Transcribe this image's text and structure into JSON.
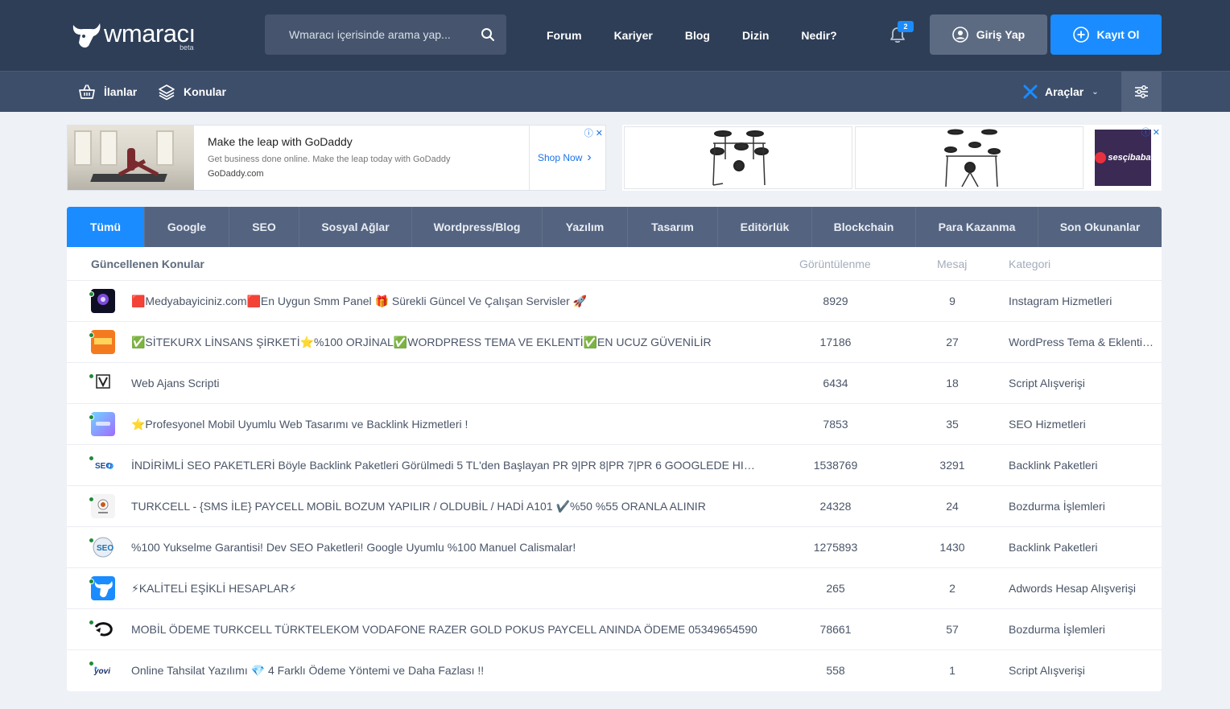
{
  "header": {
    "logo": {
      "name": "wmaracı",
      "tag": "beta"
    },
    "search": {
      "placeholder": "Wmaracı içerisinde arama yap..."
    },
    "nav": [
      "Forum",
      "Kariyer",
      "Blog",
      "Dizin",
      "Nedir?"
    ],
    "notifications": {
      "count": "2"
    },
    "login_label": "Giriş Yap",
    "register_label": "Kayıt Ol",
    "colors": {
      "bar": "#2e3e57",
      "accent": "#1a8cff"
    }
  },
  "subnav": {
    "listings_label": "İlanlar",
    "topics_label": "Konular",
    "tools_label": "Araçlar"
  },
  "ads": {
    "left": {
      "title": "Make the leap with GoDaddy",
      "description": "Get business done online. Make the leap today with GoDaddy",
      "domain": "GoDaddy.com",
      "cta": "Shop Now"
    },
    "right": {
      "brand": "sesçibaba"
    }
  },
  "tabs": [
    "Tümü",
    "Google",
    "SEO",
    "Sosyal Ağlar",
    "Wordpress/Blog",
    "Yazılım",
    "Tasarım",
    "Editörlük",
    "Blockchain",
    "Para Kazanma",
    "Son Okunanlar"
  ],
  "table": {
    "columns": {
      "title": "Güncellenen Konular",
      "views": "Görüntülenme",
      "messages": "Mesaj",
      "category": "Kategori"
    },
    "rows": [
      {
        "title": "🟥Medyabayiciniz.com🟥En Uygun Smm Panel 🎁 Sürekli Güncel Ve Çalışan Servisler 🚀",
        "views": "8929",
        "messages": "9",
        "category": "Instagram Hizmetleri",
        "avatar": "purple-orb"
      },
      {
        "title": "✅SİTEKURX LİNSANS ŞİRKETİ⭐%100 ORJİNAL✅WORDPRESS TEMA VE EKLENTİ✅EN UCUZ GÜVENİLİR",
        "views": "17186",
        "messages": "27",
        "category": "WordPress Tema & Eklenti Alışverişi",
        "avatar": "orange-tile"
      },
      {
        "title": "Web Ajans Scripti",
        "views": "6434",
        "messages": "18",
        "category": "Script Alışverişi",
        "avatar": "v-logo"
      },
      {
        "title": "⭐Profesyonel Mobil Uyumlu Web Tasarımı ve Backlink Hizmetleri !",
        "views": "7853",
        "messages": "35",
        "category": "SEO Hizmetleri",
        "avatar": "gradient-tile"
      },
      {
        "title": "İNDİRİMLİ SEO PAKETLERİ Böyle Backlink Paketleri Görülmedi 5 TL'den Başlayan PR 9|PR 8|PR 7|PR 6 GOOGLEDE HIZLI YÜKSELME",
        "views": "1538769",
        "messages": "3291",
        "category": "Backlink Paketleri",
        "avatar": "seo-logo"
      },
      {
        "title": "TURKCELL - {SMS İLE} PAYCELL MOBİL BOZUM YAPILIR / OLDUBİL / HADİ A101 ✔️%50 %55 ORANLA ALINIR",
        "views": "24328",
        "messages": "24",
        "category": "Bozdurma İşlemleri",
        "avatar": "seal-logo"
      },
      {
        "title": "%100 Yukselme Garantisi! Dev SEO Paketleri! Google Uyumlu %100 Manuel Calismalar!",
        "views": "1275893",
        "messages": "1430",
        "category": "Backlink Paketleri",
        "avatar": "seo-badge"
      },
      {
        "title": "⚡KALİTELİ EŞİKLİ HESAPLAR⚡",
        "views": "265",
        "messages": "2",
        "category": "Adwords Hesap Alışverişi",
        "avatar": "bull-blue"
      },
      {
        "title": "MOBİL ÖDEME TURKCELL TÜRKTELEKOM VODAFONE RAZER GOLD POKUS PAYCELL ANINDA ÖDEME 05349654590",
        "views": "78661",
        "messages": "57",
        "category": "Bozdurma İşlemleri",
        "avatar": "swirl-logo"
      },
      {
        "title": "Online Tahsilat Yazılımı 💎 4 Farklı Ödeme Yöntemi ve Daha Fazlası !!",
        "views": "558",
        "messages": "1",
        "category": "Script Alışverişi",
        "avatar": "yovi-logo"
      }
    ]
  }
}
